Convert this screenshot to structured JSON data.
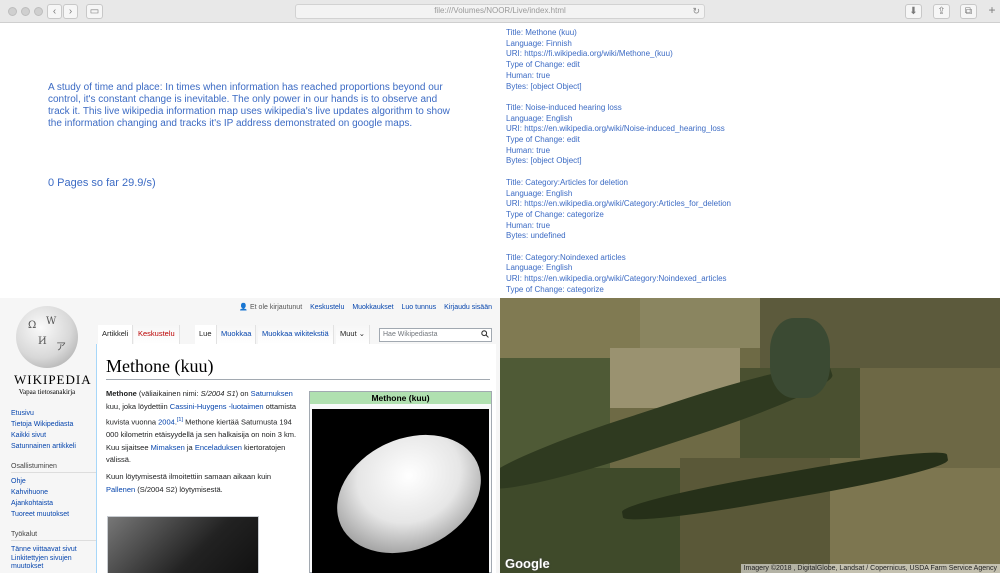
{
  "browser": {
    "url": "file:///Volumes/NOOR/Live/index.html"
  },
  "intro": {
    "text": "A study of time and place: In times when information has reached proportions beyond our control, it's constant change is inevitable. The only power in our hands is to observe and track it. This live wikipedia information map uses wikipedia's live updates algorithm to show the information changing and tracks it's IP address demonstrated on google maps."
  },
  "counter": {
    "text": "0 Pages so far 29.9/s)"
  },
  "log": [
    {
      "title": "Title: Methone (kuu)",
      "language": "Language: Finnish",
      "uri": "URI: https://fi.wikipedia.org/wiki/Methone_(kuu)",
      "type": "Type of Change: edit",
      "human": "Human: true",
      "bytes": "Bytes: [object Object]"
    },
    {
      "title": "Title: Noise-induced hearing loss",
      "language": "Language: English",
      "uri": "URI: https://en.wikipedia.org/wiki/Noise-induced_hearing_loss",
      "type": "Type of Change: edit",
      "human": "Human: true",
      "bytes": "Bytes: [object Object]"
    },
    {
      "title": "Title: Category:Articles for deletion",
      "language": "Language: English",
      "uri": "URI: https://en.wikipedia.org/wiki/Category:Articles_for_deletion",
      "type": "Type of Change: categorize",
      "human": "Human: true",
      "bytes": "Bytes: undefined"
    },
    {
      "title": "Title: Category:Noindexed articles",
      "language": "Language: English",
      "uri": "URI: https://en.wikipedia.org/wiki/Category:Noindexed_articles",
      "type": "Type of Change: categorize",
      "human": "",
      "bytes": ""
    }
  ],
  "wiki": {
    "user_links": {
      "anon": "Et ole kirjautunut",
      "talk": "Keskustelu",
      "contribs": "Muokkaukset",
      "create": "Luo tunnus",
      "login": "Kirjaudu sisään"
    },
    "logo_name": "Wikipedia",
    "logo_tagline": "Vapaa tietosanakirja",
    "tabs": {
      "article": "Artikkeli",
      "talk": "Keskustelu",
      "read": "Lue",
      "edit": "Muokkaa",
      "edit_source": "Muokkaa wikitekstiä",
      "more": "Muut"
    },
    "search_placeholder": "Hae Wikipediasta",
    "nav_main": [
      "Etusivu",
      "Tietoja Wikipediasta",
      "Kaikki sivut",
      "Satunnainen artikkeli"
    ],
    "participate_heading": "Osallistuminen",
    "nav_participate": [
      "Ohje",
      "Kahvihuone",
      "Ajankohtaista",
      "Tuoreet muutokset"
    ],
    "tools_heading": "Työkalut",
    "nav_tools": [
      "Tänne viittaavat sivut",
      "Linkitettyjen sivujen muutokset"
    ],
    "article_title": "Methone (kuu)",
    "infobox_title": "Methone (kuu)",
    "p1": {
      "name": "Methone",
      "t1": " (väliaikainen nimi: ",
      "provisional": "S/2004 S1",
      "t2": ") on ",
      "saturn": "Saturnuksen",
      "t3": " kuu, joka löydettiin ",
      "cassini": "Cassini-Huygens -luotaimen",
      "t4": " ottamista kuvista vuonna ",
      "year": "2004",
      "ref": "[1]",
      "t5": " Methone kiertää Saturnusta 194 000 kilometrin etäisyydellä ja sen halkaisija on noin 3 km. Kuu sijaitsee ",
      "mimas": "Mimaksen",
      "t6": " ja ",
      "enceladus": "Enceladuksen",
      "t7": " kiertoratojen välissä."
    },
    "p2": {
      "t1": "Kuun löytymisestä ilmoitettiin samaan aikaan kuin ",
      "pallene": "Pallenen",
      "t2": " (S/2004 S2) löytymisestä."
    }
  },
  "map": {
    "brand": "Google",
    "attribution": "Imagery ©2018 , DigitalGlobe, Landsat / Copernicus, USDA Farm Service Agency"
  }
}
